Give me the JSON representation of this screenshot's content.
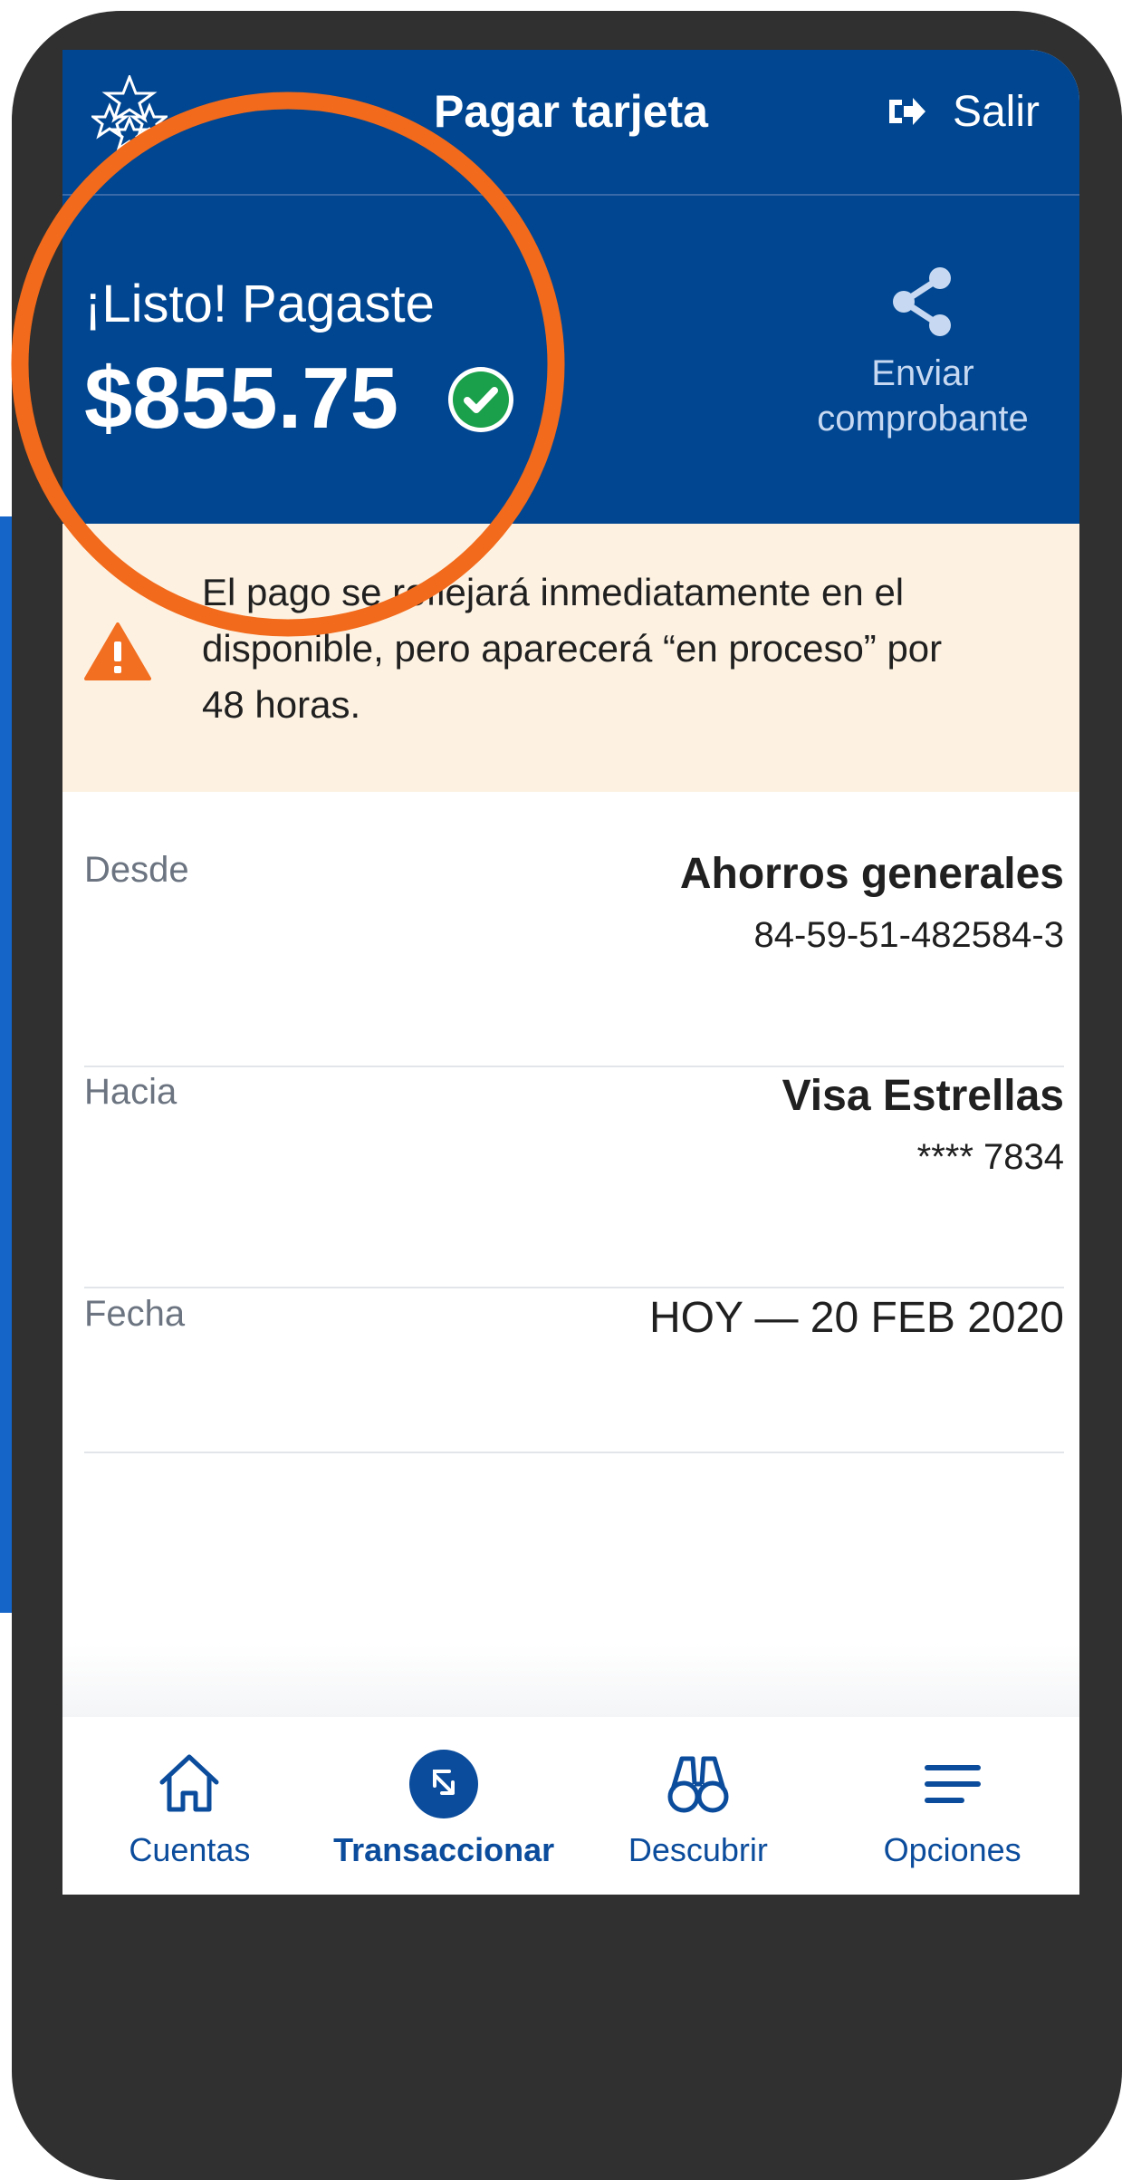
{
  "header": {
    "title": "Pagar tarjeta",
    "logout_label": "Salir"
  },
  "confirmation": {
    "status_text": "¡Listo! Pagaste",
    "amount": "$855.75",
    "share_label_line1": "Enviar",
    "share_label_line2": "comprobante"
  },
  "warning": {
    "line1": "El pago se reflejará inmediatamente en el",
    "line2": "disponible, pero aparecerá “en proceso” por",
    "line3": "48 horas."
  },
  "details": {
    "from": {
      "label": "Desde",
      "account_name": "Ahorros generales",
      "account_number": "84-59-51-482584-3"
    },
    "to": {
      "label": "Hacia",
      "card_name": "Visa Estrellas",
      "card_number": "**** 7834"
    },
    "date": {
      "label": "Fecha",
      "value": "HOY — 20 FEB 2020"
    }
  },
  "bottom_nav": {
    "items": [
      {
        "label": "Cuentas",
        "icon": "home-icon"
      },
      {
        "label": "Transaccionar",
        "icon": "transfer-icon",
        "active": true
      },
      {
        "label": "Descubrir",
        "icon": "binoculars-icon"
      },
      {
        "label": "Opciones",
        "icon": "menu-icon"
      }
    ]
  },
  "colors": {
    "brand_blue": "#004691",
    "warning_bg": "#fdf2e2",
    "warning_orange": "#f26f21",
    "success_green": "#1aa04a",
    "annotation_orange": "#f26a1b",
    "frame": "#303030"
  }
}
